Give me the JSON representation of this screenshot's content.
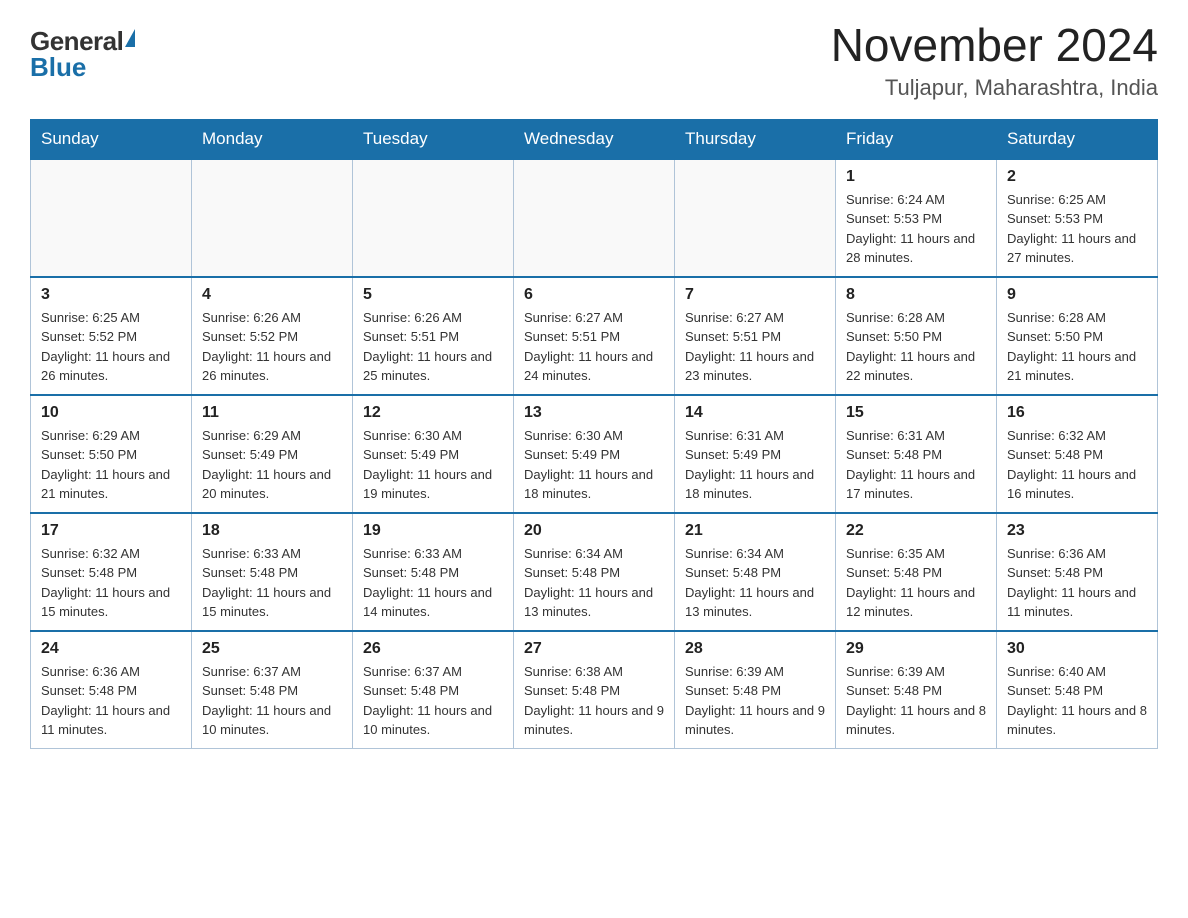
{
  "header": {
    "logo_general": "General",
    "logo_blue": "Blue",
    "title": "November 2024",
    "subtitle": "Tuljapur, Maharashtra, India"
  },
  "calendar": {
    "days_of_week": [
      "Sunday",
      "Monday",
      "Tuesday",
      "Wednesday",
      "Thursday",
      "Friday",
      "Saturday"
    ],
    "weeks": [
      [
        {
          "day": "",
          "info": ""
        },
        {
          "day": "",
          "info": ""
        },
        {
          "day": "",
          "info": ""
        },
        {
          "day": "",
          "info": ""
        },
        {
          "day": "",
          "info": ""
        },
        {
          "day": "1",
          "info": "Sunrise: 6:24 AM\nSunset: 5:53 PM\nDaylight: 11 hours and 28 minutes."
        },
        {
          "day": "2",
          "info": "Sunrise: 6:25 AM\nSunset: 5:53 PM\nDaylight: 11 hours and 27 minutes."
        }
      ],
      [
        {
          "day": "3",
          "info": "Sunrise: 6:25 AM\nSunset: 5:52 PM\nDaylight: 11 hours and 26 minutes."
        },
        {
          "day": "4",
          "info": "Sunrise: 6:26 AM\nSunset: 5:52 PM\nDaylight: 11 hours and 26 minutes."
        },
        {
          "day": "5",
          "info": "Sunrise: 6:26 AM\nSunset: 5:51 PM\nDaylight: 11 hours and 25 minutes."
        },
        {
          "day": "6",
          "info": "Sunrise: 6:27 AM\nSunset: 5:51 PM\nDaylight: 11 hours and 24 minutes."
        },
        {
          "day": "7",
          "info": "Sunrise: 6:27 AM\nSunset: 5:51 PM\nDaylight: 11 hours and 23 minutes."
        },
        {
          "day": "8",
          "info": "Sunrise: 6:28 AM\nSunset: 5:50 PM\nDaylight: 11 hours and 22 minutes."
        },
        {
          "day": "9",
          "info": "Sunrise: 6:28 AM\nSunset: 5:50 PM\nDaylight: 11 hours and 21 minutes."
        }
      ],
      [
        {
          "day": "10",
          "info": "Sunrise: 6:29 AM\nSunset: 5:50 PM\nDaylight: 11 hours and 21 minutes."
        },
        {
          "day": "11",
          "info": "Sunrise: 6:29 AM\nSunset: 5:49 PM\nDaylight: 11 hours and 20 minutes."
        },
        {
          "day": "12",
          "info": "Sunrise: 6:30 AM\nSunset: 5:49 PM\nDaylight: 11 hours and 19 minutes."
        },
        {
          "day": "13",
          "info": "Sunrise: 6:30 AM\nSunset: 5:49 PM\nDaylight: 11 hours and 18 minutes."
        },
        {
          "day": "14",
          "info": "Sunrise: 6:31 AM\nSunset: 5:49 PM\nDaylight: 11 hours and 18 minutes."
        },
        {
          "day": "15",
          "info": "Sunrise: 6:31 AM\nSunset: 5:48 PM\nDaylight: 11 hours and 17 minutes."
        },
        {
          "day": "16",
          "info": "Sunrise: 6:32 AM\nSunset: 5:48 PM\nDaylight: 11 hours and 16 minutes."
        }
      ],
      [
        {
          "day": "17",
          "info": "Sunrise: 6:32 AM\nSunset: 5:48 PM\nDaylight: 11 hours and 15 minutes."
        },
        {
          "day": "18",
          "info": "Sunrise: 6:33 AM\nSunset: 5:48 PM\nDaylight: 11 hours and 15 minutes."
        },
        {
          "day": "19",
          "info": "Sunrise: 6:33 AM\nSunset: 5:48 PM\nDaylight: 11 hours and 14 minutes."
        },
        {
          "day": "20",
          "info": "Sunrise: 6:34 AM\nSunset: 5:48 PM\nDaylight: 11 hours and 13 minutes."
        },
        {
          "day": "21",
          "info": "Sunrise: 6:34 AM\nSunset: 5:48 PM\nDaylight: 11 hours and 13 minutes."
        },
        {
          "day": "22",
          "info": "Sunrise: 6:35 AM\nSunset: 5:48 PM\nDaylight: 11 hours and 12 minutes."
        },
        {
          "day": "23",
          "info": "Sunrise: 6:36 AM\nSunset: 5:48 PM\nDaylight: 11 hours and 11 minutes."
        }
      ],
      [
        {
          "day": "24",
          "info": "Sunrise: 6:36 AM\nSunset: 5:48 PM\nDaylight: 11 hours and 11 minutes."
        },
        {
          "day": "25",
          "info": "Sunrise: 6:37 AM\nSunset: 5:48 PM\nDaylight: 11 hours and 10 minutes."
        },
        {
          "day": "26",
          "info": "Sunrise: 6:37 AM\nSunset: 5:48 PM\nDaylight: 11 hours and 10 minutes."
        },
        {
          "day": "27",
          "info": "Sunrise: 6:38 AM\nSunset: 5:48 PM\nDaylight: 11 hours and 9 minutes."
        },
        {
          "day": "28",
          "info": "Sunrise: 6:39 AM\nSunset: 5:48 PM\nDaylight: 11 hours and 9 minutes."
        },
        {
          "day": "29",
          "info": "Sunrise: 6:39 AM\nSunset: 5:48 PM\nDaylight: 11 hours and 8 minutes."
        },
        {
          "day": "30",
          "info": "Sunrise: 6:40 AM\nSunset: 5:48 PM\nDaylight: 11 hours and 8 minutes."
        }
      ]
    ]
  }
}
